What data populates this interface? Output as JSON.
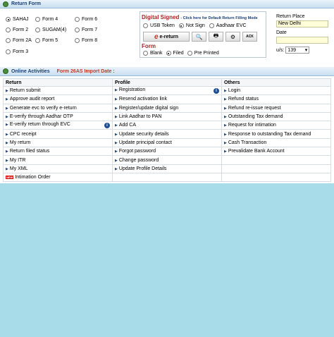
{
  "return_form": {
    "title": "Return Form",
    "forms": [
      {
        "label": "SAHAJ",
        "selected": true
      },
      {
        "label": "Form 4",
        "selected": false
      },
      {
        "label": "Form 6",
        "selected": false
      },
      {
        "label": "Form 2",
        "selected": false
      },
      {
        "label": "SUGAM(4)",
        "selected": false
      },
      {
        "label": "Form 7",
        "selected": false
      },
      {
        "label": "Form 2A",
        "selected": false
      },
      {
        "label": "Form 5",
        "selected": false
      },
      {
        "label": "Form 8",
        "selected": false
      },
      {
        "label": "Form 3",
        "selected": false
      }
    ],
    "digital_signed": {
      "title": "Digital Signed",
      "hint": "- Click here for Default Return Filling Mode",
      "options": [
        {
          "label": "USB Token",
          "selected": false
        },
        {
          "label": "Not Sign",
          "selected": true
        },
        {
          "label": "Aadhaar EVC",
          "selected": false
        }
      ],
      "ereturn_label": "e-return",
      "ereturn_icon": "e",
      "tool_icons": [
        "🔍",
        "🖶",
        "⚙",
        "ACK"
      ]
    },
    "form_mode": {
      "title": "Form",
      "options": [
        {
          "label": "Blank",
          "selected": false
        },
        {
          "label": "Filed",
          "selected": true
        },
        {
          "label": "Pre Printed",
          "selected": false
        }
      ]
    },
    "return_place_label": "Return Place",
    "return_place_value": "New Delhi",
    "date_label": "Date",
    "date_value": "",
    "us_label": "u/s:",
    "us_value": "139"
  },
  "online_activities": {
    "title": "Online Activities",
    "form26": "Form 26AS Import Date :",
    "columns": [
      "Return",
      "Profile",
      "Others"
    ],
    "rows": [
      [
        "Return submit",
        "Registration",
        "Login"
      ],
      [
        "Approve audit report",
        "Resend activation link",
        "Refund status"
      ],
      [
        "Generate evc to verify e-return",
        "Register/update digital sign",
        "Refund re-issue request"
      ],
      [
        "E-verify through Aadhar OTP",
        "Link Aadhar to PAN",
        "Outstanding Tax demand"
      ],
      [
        "E-verify return through EVC",
        "Add CA",
        "Request for intimation"
      ],
      [
        "CPC receipt",
        "Update security details",
        "Response to outstanding Tax demand"
      ],
      [
        "My return",
        "Update principal contact",
        "Cash Transaction"
      ],
      [
        "Return filed status",
        "Forgot password",
        "Prevalidate Bank Account"
      ],
      [
        "My ITR",
        "Change password",
        ""
      ],
      [
        "My XML",
        "Update Profile Details",
        ""
      ],
      [
        "Intimation Order",
        "",
        ""
      ]
    ],
    "new_badge": "NEW"
  }
}
